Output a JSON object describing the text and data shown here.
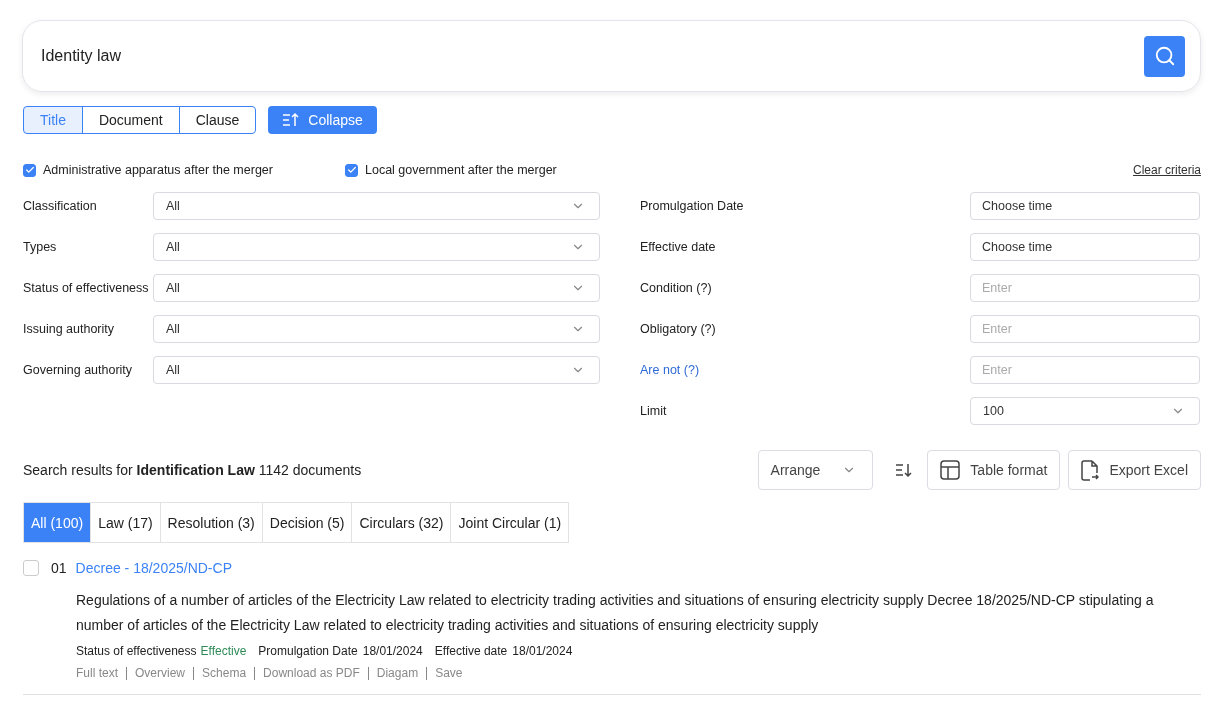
{
  "search": {
    "value": "Identity law"
  },
  "modes": [
    {
      "label": "Title",
      "selected": true
    },
    {
      "label": "Document",
      "selected": false
    },
    {
      "label": "Clause",
      "selected": false
    }
  ],
  "collapse_button": {
    "label": "Collapse"
  },
  "options": [
    {
      "label": "Administrative apparatus after the merger",
      "checked": true
    },
    {
      "label": "Local government after the merger",
      "checked": true
    }
  ],
  "clear_link": "Clear criteria",
  "left_filters": [
    {
      "label": "Classification",
      "value": "All"
    },
    {
      "label": "Types",
      "value": "All"
    },
    {
      "label": "Status of effectiveness",
      "value": "All"
    },
    {
      "label": "Issuing authority",
      "value": "All"
    },
    {
      "label": "Governing authority",
      "value": "All"
    }
  ],
  "right_filters": [
    {
      "label": "Promulgation Date",
      "kind": "date",
      "value": "Choose time",
      "highlighted": false
    },
    {
      "label": "Effective date",
      "kind": "date",
      "value": "Choose time",
      "highlighted": false
    },
    {
      "label": "Condition (?)",
      "kind": "text",
      "placeholder": "Enter",
      "highlighted": false
    },
    {
      "label": "Obligatory (?)",
      "kind": "text",
      "placeholder": "Enter",
      "highlighted": false
    },
    {
      "label": "Are not (?)",
      "kind": "text",
      "placeholder": "Enter",
      "highlighted": true
    },
    {
      "label": "Limit",
      "kind": "select",
      "value": "100",
      "highlighted": false
    }
  ],
  "results_summary": "Search results for **Identification Law** 1142 documents",
  "arrange": {
    "label": "Arrange"
  },
  "table_format": {
    "label": "Table format"
  },
  "export": {
    "label": "Export Excel"
  },
  "categories": [
    {
      "label": "All (100)",
      "selected": true
    },
    {
      "label": "Law (17)",
      "selected": false
    },
    {
      "label": "Resolution (3)",
      "selected": false
    },
    {
      "label": "Decision (5)",
      "selected": false
    },
    {
      "label": "Circulars (32)",
      "selected": false
    },
    {
      "label": "Joint Circular (1)",
      "selected": false
    }
  ],
  "results": [
    {
      "checked": false,
      "number": "01",
      "title": "Decree - 18/2025/ND-CP",
      "summary": "Regulations of a number of articles of the Electricity Law related to electricity trading activities and situations of ensuring electricity supply Decree 18/2025/ND-CP stipulating a number of articles of the Electricity Law related to electricity trading activities and situations of ensuring electricity supply",
      "status_label": "Status of effectiveness",
      "status": "Effective",
      "promulgation_label": "Promulgation Date",
      "promulgation": "18/01/2024",
      "effective_label": "Effective date",
      "effective": "18/01/2024",
      "actions": [
        "Full text",
        "Overview",
        "Schema",
        "Download as PDF",
        "Diagam",
        "Save"
      ]
    }
  ]
}
